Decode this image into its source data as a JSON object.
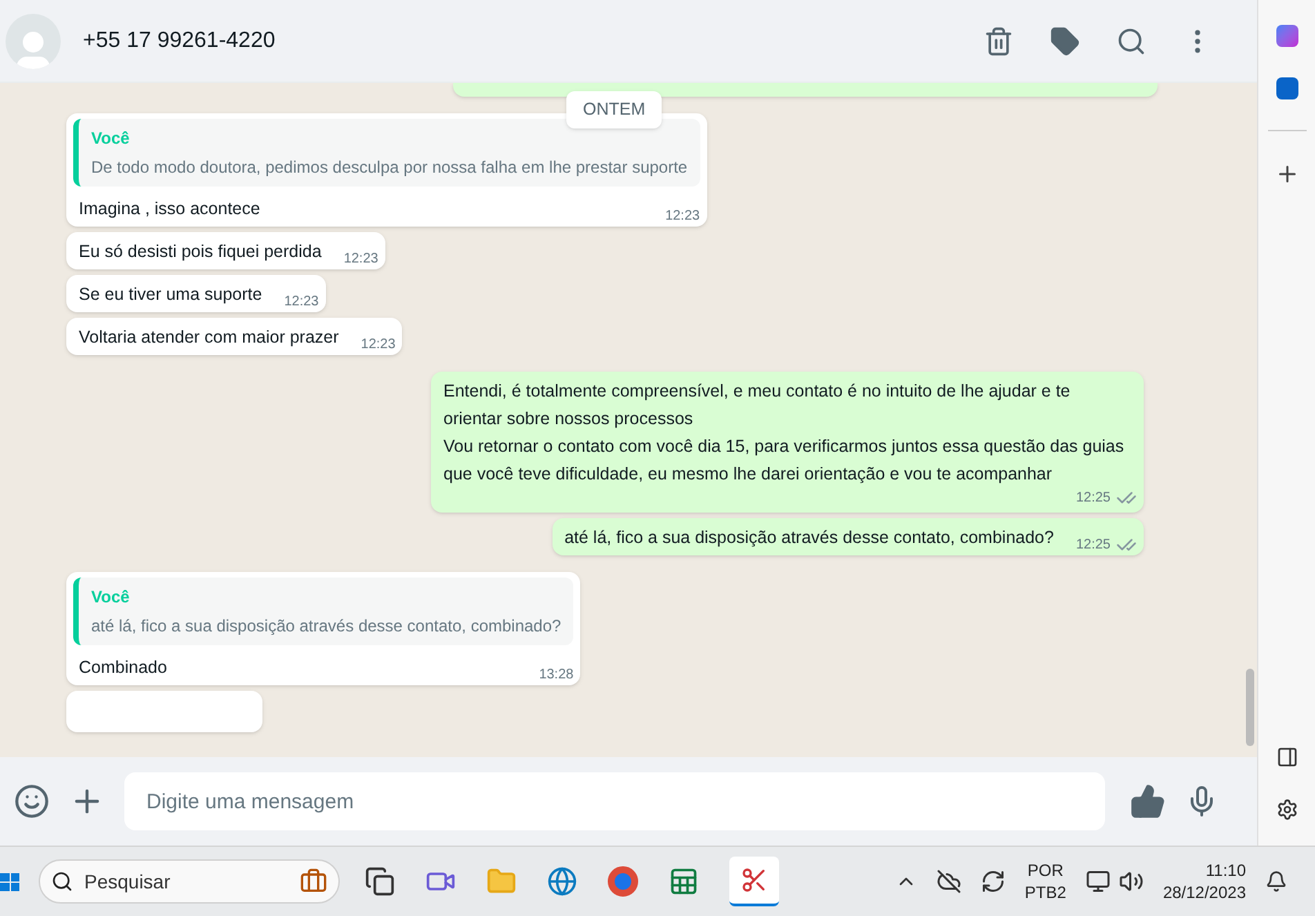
{
  "header": {
    "contact": "+55 17 99261-4220"
  },
  "day_chip": "ONTEM",
  "messages": [
    {
      "kind": "in",
      "quote": {
        "author": "Você",
        "text": "De todo modo doutora, pedimos desculpa por nossa falha em lhe prestar suporte"
      },
      "text": "Imagina , isso acontece",
      "time": "12:23"
    },
    {
      "kind": "in",
      "text": "Eu só desisti pois fiquei perdida",
      "time": "12:23"
    },
    {
      "kind": "in",
      "text": "Se eu tiver uma suporte",
      "time": "12:23"
    },
    {
      "kind": "in",
      "text": "Voltaria atender com maior prazer",
      "time": "12:23"
    },
    {
      "kind": "out",
      "text": "Entendi, é totalmente compreensível, e meu contato é no intuito de lhe ajudar e te orientar sobre nossos processos\nVou retornar o contato com você dia 15, para verificarmos juntos essa questão das guias que você teve dificuldade, eu mesmo lhe darei orientação e vou te acompanhar",
      "time": "12:25",
      "read": false
    },
    {
      "kind": "out",
      "text": "até lá, fico a sua disposição através desse contato, combinado?",
      "time": "12:25",
      "read": false
    },
    {
      "kind": "in",
      "quote": {
        "author": "Você",
        "text": "até lá, fico a sua disposição através desse contato, combinado?"
      },
      "text": "Combinado",
      "time": "13:28"
    }
  ],
  "composer": {
    "placeholder": "Digite uma mensagem"
  },
  "taskbar": {
    "search_placeholder": "Pesquisar",
    "language": "POR",
    "layout": "PTB2",
    "time": "11:10",
    "date": "28/12/2023"
  }
}
